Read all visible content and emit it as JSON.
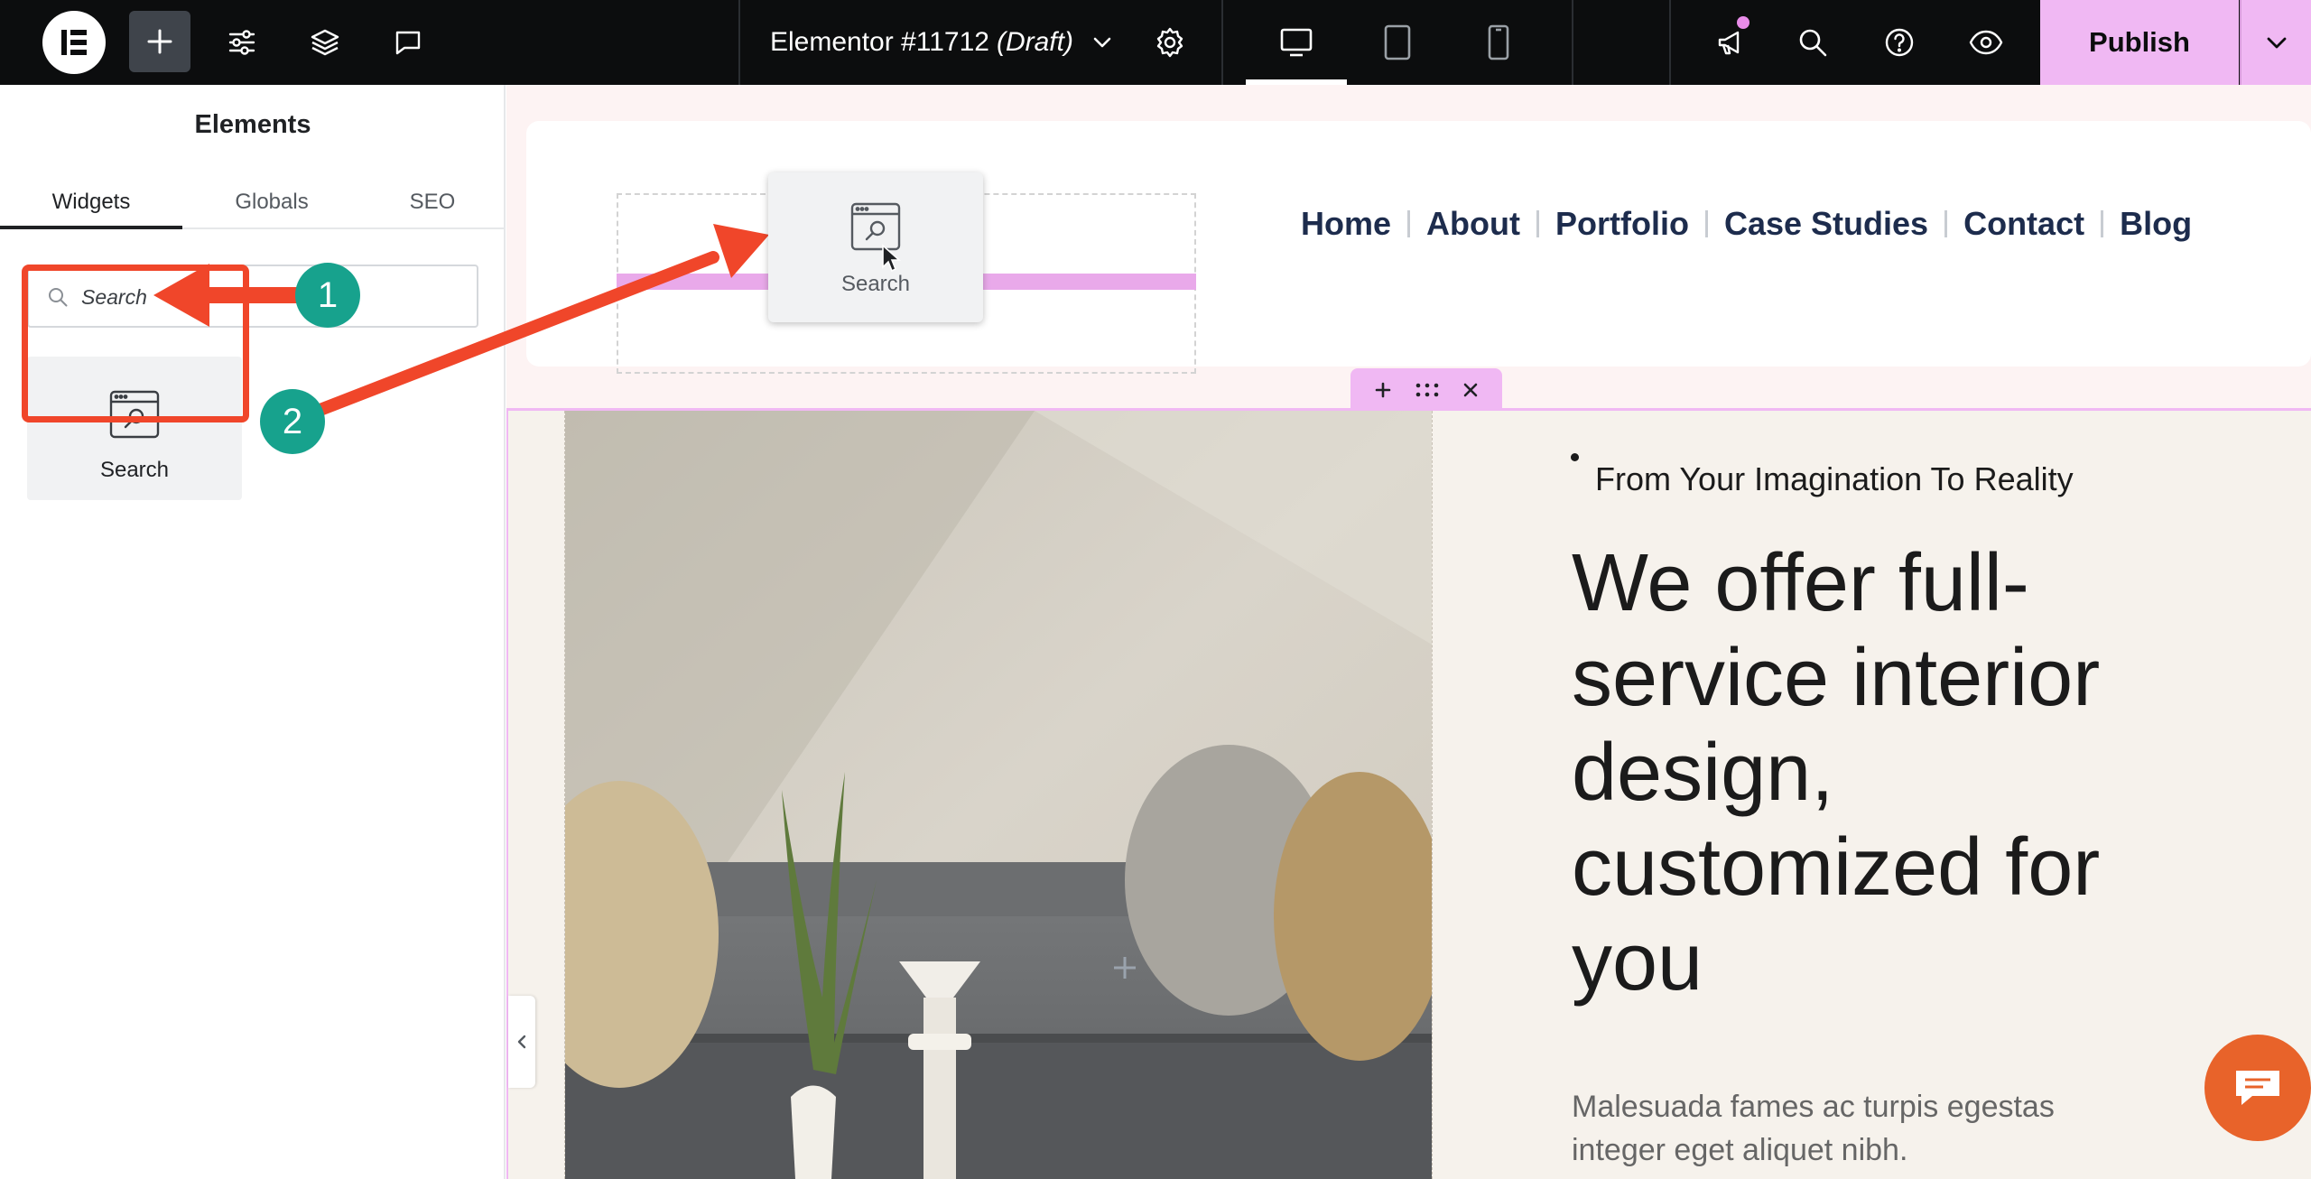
{
  "topbar": {
    "logo_icon": "elementor-logo-icon",
    "add_icon": "plus-icon",
    "site_settings_icon": "sliders-icon",
    "structure_icon": "layers-icon",
    "notes_icon": "comment-icon",
    "document_title": "Elementor #11712",
    "document_status": "(Draft)",
    "title_caret_icon": "chevron-down-icon",
    "page_settings_icon": "gear-icon",
    "devices": [
      "desktop-icon",
      "tablet-icon",
      "mobile-icon"
    ],
    "active_device": "desktop",
    "whats_new_icon": "megaphone-icon",
    "finder_icon": "search-icon",
    "help_icon": "help-icon",
    "preview_icon": "eye-icon",
    "publish_label": "Publish",
    "publish_caret_icon": "chevron-down-icon"
  },
  "panel": {
    "title": "Elements",
    "tabs": [
      {
        "label": "Widgets",
        "active": true
      },
      {
        "label": "Globals",
        "active": false
      },
      {
        "label": "SEO",
        "active": false
      }
    ],
    "search": {
      "placeholder": "Search",
      "value": ""
    },
    "widgets": [
      {
        "label": "Search",
        "icon": "search-widget-icon"
      }
    ]
  },
  "canvas": {
    "nav_items": [
      "Home",
      "About",
      "Portfolio",
      "Case Studies",
      "Contact",
      "Blog"
    ],
    "dragged_widget_label": "Search",
    "section_toolbar": [
      "plus-icon",
      "drag-handle-icon",
      "close-icon"
    ],
    "hero": {
      "eyebrow": "From Your Imagination To Reality",
      "headline_lines": [
        "We offer full-",
        "service interior",
        "design,",
        "customized for",
        "you"
      ],
      "body_lines": [
        "Malesuada fames ac turpis egestas",
        "integer eget aliquet nibh."
      ]
    },
    "chat_icon": "chat-bubble-icon"
  },
  "annotations": {
    "step1": "1",
    "step2": "2",
    "arrow_color": "#f0462a",
    "badge_color": "#17a28d"
  },
  "colors": {
    "accent_pink": "#f0b8f3",
    "topbar_bg": "#0c0d0e",
    "nav_text": "#1d2c4d"
  }
}
